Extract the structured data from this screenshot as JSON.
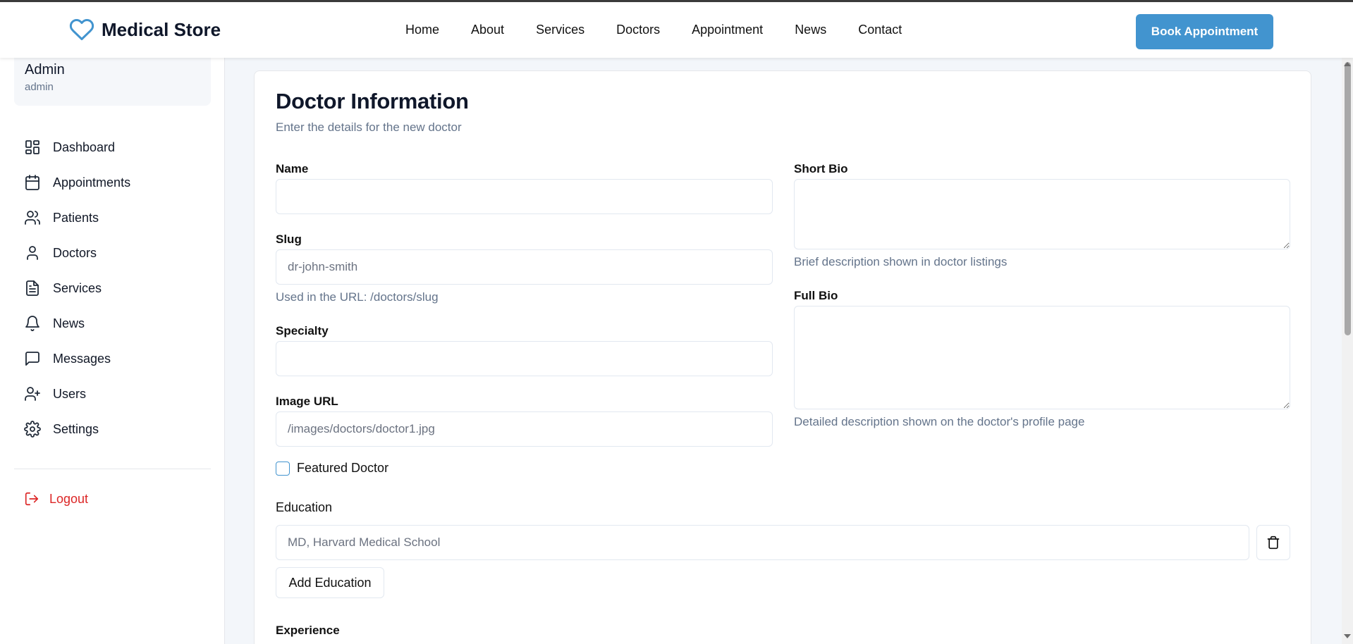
{
  "brand": {
    "name": "Medical Store",
    "accent": "#4294cf"
  },
  "nav": {
    "items": [
      "Home",
      "About",
      "Services",
      "Doctors",
      "Appointment",
      "News",
      "Contact"
    ],
    "cta": "Book Appointment"
  },
  "sidebar": {
    "user": {
      "name": "Admin",
      "role": "admin"
    },
    "items": [
      {
        "label": "Dashboard",
        "icon": "dashboard-icon"
      },
      {
        "label": "Appointments",
        "icon": "calendar-icon"
      },
      {
        "label": "Patients",
        "icon": "users-icon"
      },
      {
        "label": "Doctors",
        "icon": "user-icon"
      },
      {
        "label": "Services",
        "icon": "document-icon"
      },
      {
        "label": "News",
        "icon": "bell-icon"
      },
      {
        "label": "Messages",
        "icon": "message-icon"
      },
      {
        "label": "Users",
        "icon": "user-plus-icon"
      },
      {
        "label": "Settings",
        "icon": "gear-icon"
      }
    ],
    "logout": "Logout",
    "logout_color": "#dc2626"
  },
  "form": {
    "title": "Doctor Information",
    "subtitle": "Enter the details for the new doctor",
    "name": {
      "label": "Name",
      "value": "",
      "placeholder": ""
    },
    "slug": {
      "label": "Slug",
      "placeholder": "dr-john-smith",
      "help": "Used in the URL: /doctors/slug"
    },
    "specialty": {
      "label": "Specialty",
      "value": "",
      "placeholder": ""
    },
    "image_url": {
      "label": "Image URL",
      "placeholder": "/images/doctors/doctor1.jpg"
    },
    "featured": {
      "label": "Featured Doctor",
      "checked": false
    },
    "short_bio": {
      "label": "Short Bio",
      "help": "Brief description shown in doctor listings"
    },
    "full_bio": {
      "label": "Full Bio",
      "help": "Detailed description shown on the doctor's profile page"
    },
    "education": {
      "label": "Education",
      "placeholder": "MD, Harvard Medical School",
      "add_label": "Add Education"
    },
    "experience": {
      "label": "Experience"
    }
  }
}
